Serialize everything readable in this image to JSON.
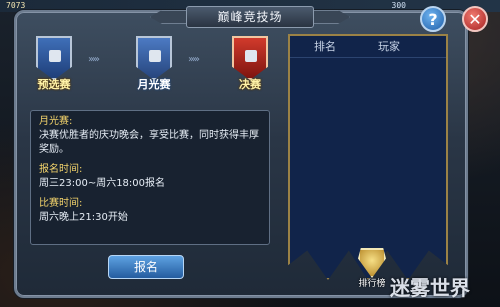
{
  "status": {
    "left_number": "7073",
    "right_number": "300"
  },
  "window": {
    "title": "巅峰竞技场",
    "help_label": "?",
    "close_label": "✕"
  },
  "stages": [
    {
      "label": "预选赛",
      "icon": "shield-lock-icon",
      "state": "done"
    },
    {
      "label": "月光赛",
      "icon": "shield-lock-icon",
      "state": "current"
    },
    {
      "label": "决赛",
      "icon": "shield-lock-icon",
      "state": "next"
    }
  ],
  "info": {
    "section1_title": "月光赛:",
    "section1_text": "决赛优胜者的庆功晚会，享受比赛，同时获得丰厚奖励。",
    "section2_title": "报名时间:",
    "section2_text": "周三23:00~周六18:00报名",
    "section3_title": "比赛时间:",
    "section3_text": "周六晚上21:30开始"
  },
  "actions": {
    "signup_label": "报名"
  },
  "ranking": {
    "col_rank": "排名",
    "col_player": "玩家",
    "rank_button_label": "排行榜"
  },
  "watermark": {
    "text": "迷雾世界"
  },
  "colors": {
    "gold_text": "#f2d36b",
    "banner_bg": "#11244a",
    "button_blue": "#245c9f"
  }
}
